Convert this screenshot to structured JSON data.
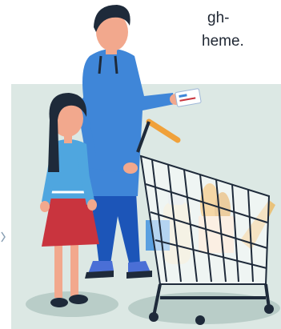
{
  "visible_text": {
    "line_1": "gh-",
    "line_2": "heme."
  },
  "colors": {
    "panel_bg": "#dce8e4",
    "man_shirt": "#3f86d8",
    "man_pants": "#1c55b8",
    "girl_top": "#4fa6df",
    "girl_skirt": "#c9343e",
    "skin": "#f2a88d",
    "hair": "#1e2a3a",
    "cart_basket": "#ffffff",
    "cart_frame": "#1e2a3a",
    "cart_handle": "#f0a13a"
  },
  "icons": [
    "shopping-cart-icon",
    "credit-card-icon"
  ]
}
